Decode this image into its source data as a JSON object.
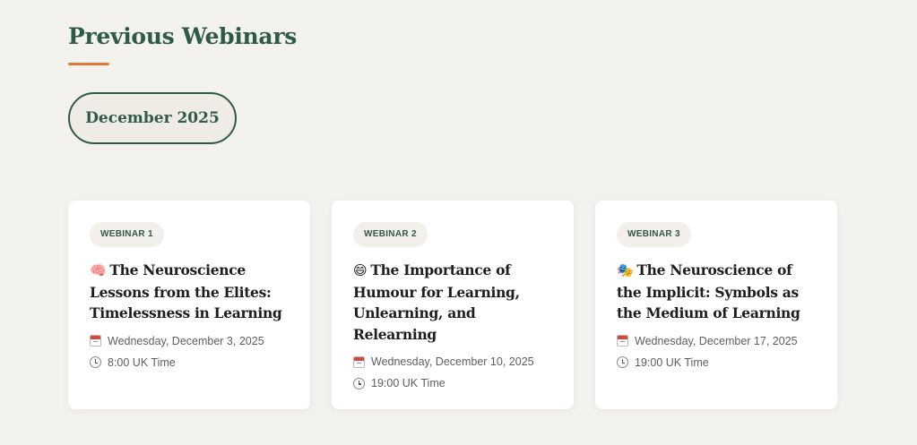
{
  "section": {
    "title": "Previous Webinars",
    "accent_color": "#e07b39",
    "brand_color": "#2e5b45"
  },
  "month_filter": {
    "label": "December 2025"
  },
  "webinars": [
    {
      "badge": "WEBINAR 1",
      "emoji": "🧠",
      "emoji_icon": "brain-icon",
      "title": "The Neuroscience Lessons from the Elites: Timelessness in Learning",
      "date": "Wednesday, December 3, 2025",
      "time": "8:00 UK Time"
    },
    {
      "badge": "WEBINAR 2",
      "emoji": "😄",
      "emoji_icon": "smiling-face-icon",
      "title": "The Importance of Humour for Learning, Unlearning, and Relearning",
      "date": "Wednesday, December 10, 2025",
      "time": "19:00 UK Time"
    },
    {
      "badge": "WEBINAR 3",
      "emoji": "🎭",
      "emoji_icon": "theater-masks-icon",
      "title": "The Neuroscience of the Implicit: Symbols as the Medium of Learning",
      "date": "Wednesday, December 17, 2025",
      "time": "19:00 UK Time"
    }
  ]
}
